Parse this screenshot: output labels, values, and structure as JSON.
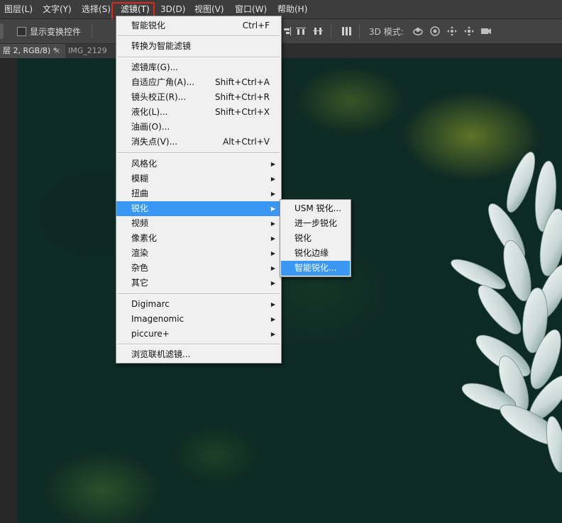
{
  "menubar": {
    "items": [
      {
        "label": "图层(L)"
      },
      {
        "label": "文字(Y)"
      },
      {
        "label": "选择(S)"
      },
      {
        "label": "滤镜(T)"
      },
      {
        "label": "3D(D)"
      },
      {
        "label": "视图(V)"
      },
      {
        "label": "窗口(W)"
      },
      {
        "label": "帮助(H)"
      }
    ]
  },
  "options_bar": {
    "show_transform_label": "显示变换控件",
    "mode_label": "3D 模式:",
    "mode_icons": [
      "orbit-icon",
      "roll-icon",
      "pan-icon",
      "slide-icon",
      "scale-camera-icon"
    ]
  },
  "tabs": [
    {
      "label": "层 2, RGB/8) *",
      "close": "×"
    },
    {
      "label": "IMG_2129"
    }
  ],
  "filter_menu": {
    "items": [
      {
        "label": "智能锐化",
        "shortcut": "Ctrl+F"
      },
      {
        "label": "转换为智能滤镜"
      },
      {
        "label": "滤镜库(G)..."
      },
      {
        "label": "自适应广角(A)...",
        "shortcut": "Shift+Ctrl+A"
      },
      {
        "label": "镜头校正(R)...",
        "shortcut": "Shift+Ctrl+R"
      },
      {
        "label": "液化(L)...",
        "shortcut": "Shift+Ctrl+X"
      },
      {
        "label": "油画(O)..."
      },
      {
        "label": "消失点(V)...",
        "shortcut": "Alt+Ctrl+V"
      },
      {
        "label": "风格化"
      },
      {
        "label": "模糊"
      },
      {
        "label": "扭曲"
      },
      {
        "label": "锐化"
      },
      {
        "label": "视频"
      },
      {
        "label": "像素化"
      },
      {
        "label": "渲染"
      },
      {
        "label": "杂色"
      },
      {
        "label": "其它"
      },
      {
        "label": "Digimarc"
      },
      {
        "label": "Imagenomic"
      },
      {
        "label": "piccure+"
      },
      {
        "label": "浏览联机滤镜..."
      }
    ]
  },
  "sharpen_submenu": {
    "items": [
      {
        "label": "USM 锐化..."
      },
      {
        "label": "进一步锐化"
      },
      {
        "label": "锐化"
      },
      {
        "label": "锐化边缘"
      },
      {
        "label": "智能锐化..."
      }
    ]
  },
  "colors": {
    "highlight": "#3a97f4",
    "annotation_box": "#e0281d"
  }
}
